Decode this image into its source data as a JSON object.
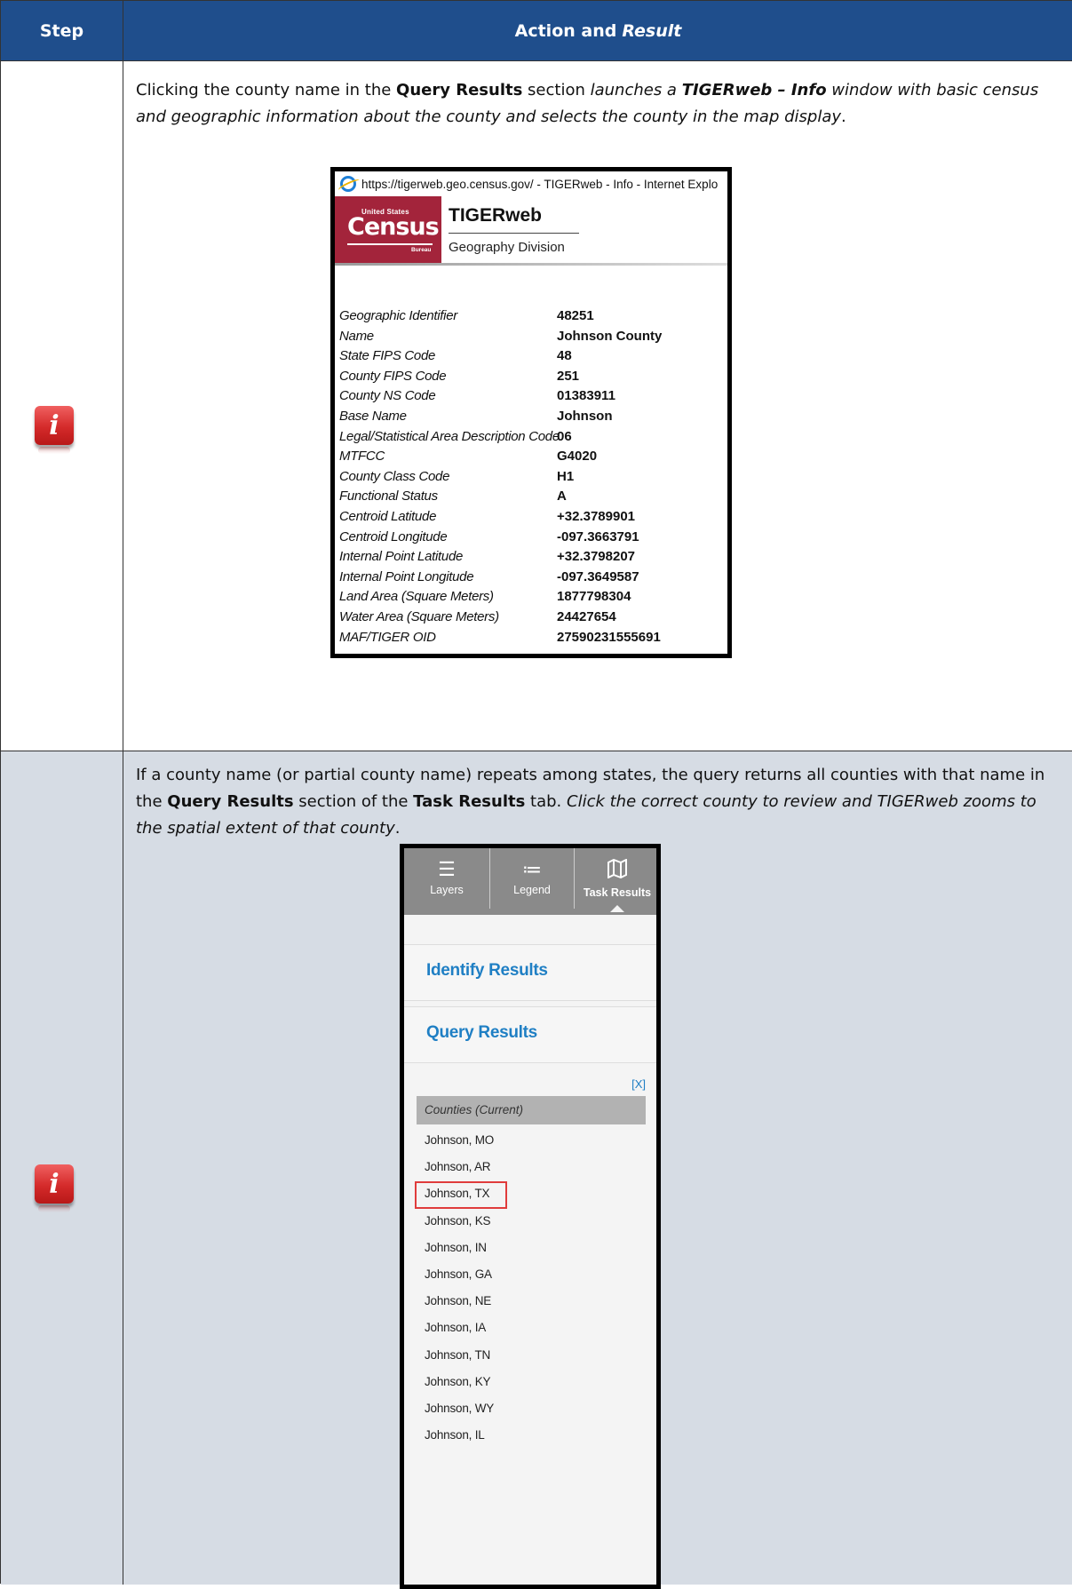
{
  "header": {
    "step": "Step",
    "action": "Action and",
    "result": "Result"
  },
  "row1": {
    "icon": "info-icon",
    "text_a": "Clicking the county name in the ",
    "bold_a": "Query Results",
    "text_b": " section ",
    "italic_a": "launches a ",
    "bold_italic": "TIGERweb – Info",
    "italic_b": " window with basic census and geographic information about the county and selects the county in the map display",
    "text_end": ".",
    "window": {
      "titlebar": "https://tigerweb.geo.census.gov/ - TIGERweb - Info - Internet Explo",
      "logo_top": "United States",
      "logo_word": "Census",
      "logo_bottom": "Bureau",
      "app_title": "TIGERweb",
      "app_subtitle": "Geography Division",
      "attributes": [
        {
          "label": "Geographic Identifier",
          "value": "48251"
        },
        {
          "label": "Name",
          "value": "Johnson County"
        },
        {
          "label": "State FIPS Code",
          "value": "48"
        },
        {
          "label": "County FIPS Code",
          "value": "251"
        },
        {
          "label": "County NS Code",
          "value": "01383911"
        },
        {
          "label": "Base Name",
          "value": "Johnson"
        },
        {
          "label": "Legal/Statistical Area Description Code",
          "value": "06"
        },
        {
          "label": "MTFCC",
          "value": "G4020"
        },
        {
          "label": "County Class Code",
          "value": "H1"
        },
        {
          "label": "Functional Status",
          "value": "A"
        },
        {
          "label": "Centroid Latitude",
          "value": "+32.3789901"
        },
        {
          "label": "Centroid Longitude",
          "value": "-097.3663791"
        },
        {
          "label": "Internal Point Latitude",
          "value": "+32.3798207"
        },
        {
          "label": "Internal Point Longitude",
          "value": "-097.3649587"
        },
        {
          "label": "Land Area (Square Meters)",
          "value": "1877798304"
        },
        {
          "label": "Water Area (Square Meters)",
          "value": "24427654"
        },
        {
          "label": "MAF/TIGER OID",
          "value": "27590231555691"
        }
      ]
    }
  },
  "row2": {
    "icon": "info-icon",
    "text_a": "If a county name (or partial county name) repeats among states, the query returns all counties with that name in the ",
    "bold_a": "Query Results",
    "text_b": " section of the ",
    "bold_b": "Task Results",
    "text_c": " tab. ",
    "italic_a": "Click the correct county to review and TIGERweb zooms to the spatial extent of that county",
    "text_end": ".",
    "panel": {
      "tabs": [
        {
          "label": "Layers",
          "icon": "layers-icon"
        },
        {
          "label": "Legend",
          "icon": "legend-icon"
        },
        {
          "label": "Task Results",
          "icon": "map-icon"
        }
      ],
      "identify_results": "Identify Results",
      "query_results": "Query Results",
      "close": "[X]",
      "group": "Counties (Current)",
      "counties": [
        "Johnson, MO",
        "Johnson, AR",
        "Johnson, TX",
        "Johnson, KS",
        "Johnson, IN",
        "Johnson, GA",
        "Johnson, NE",
        "Johnson, IA",
        "Johnson, TN",
        "Johnson, KY",
        "Johnson, WY",
        "Johnson, IL"
      ],
      "highlighted": "Johnson, TX"
    }
  }
}
